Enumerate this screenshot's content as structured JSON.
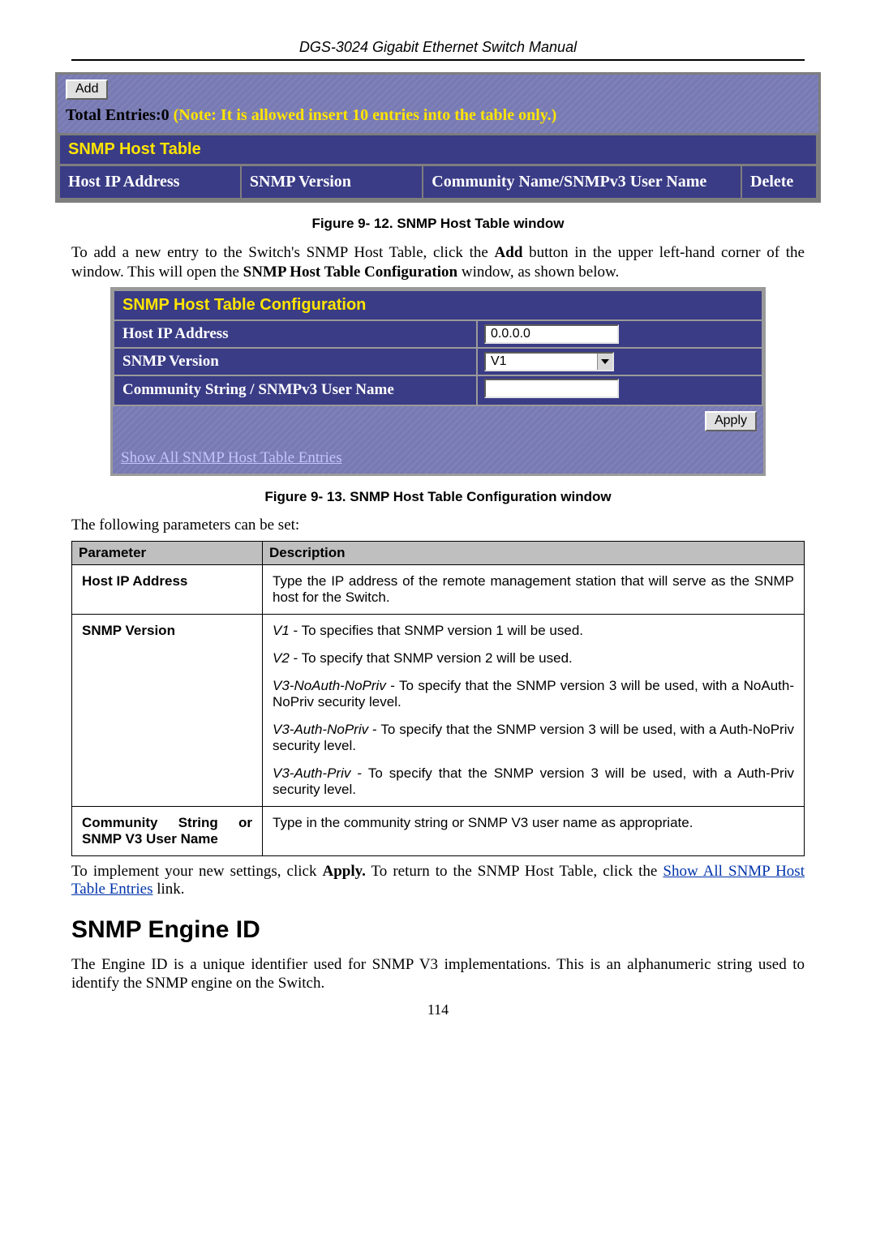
{
  "header": {
    "doc_title": "DGS-3024 Gigabit Ethernet Switch Manual"
  },
  "shot1": {
    "add_btn": "Add",
    "total_prefix": "Total Entries:0 ",
    "total_note": "(Note: It is allowed insert 10 entries into the table only.)",
    "table_title": "SNMP Host Table",
    "cols": {
      "c0": "Host IP Address",
      "c1": "SNMP Version",
      "c2": "Community Name/SNMPv3 User Name",
      "c3": "Delete"
    }
  },
  "caption1": "Figure 9- 12. SNMP Host Table window",
  "para1_a": "To add a new entry to the Switch's SNMP Host Table, click the ",
  "para1_bold": "Add",
  "para1_b": " button in the upper left-hand corner of the window. This will open the ",
  "para1_bold2": "SNMP Host Table Configuration",
  "para1_c": " window, as shown below.",
  "shot2": {
    "title": "SNMP Host Table Configuration",
    "rows": {
      "r0": "Host IP Address",
      "r1": "SNMP Version",
      "r2": "Community String / SNMPv3 User Name"
    },
    "ip_value": "0.0.0.0",
    "ver_value": "V1",
    "community_value": "",
    "apply": "Apply",
    "link": "Show All SNMP Host Table Entries"
  },
  "caption2": "Figure 9- 13. SNMP Host Table Configuration window",
  "param_intro": "The following parameters can be set:",
  "param_head": {
    "c0": "Parameter",
    "c1": "Description"
  },
  "params": {
    "p0": {
      "name": "Host IP Address",
      "desc": "Type the IP address of the remote management station that will serve as the SNMP host for the Switch."
    },
    "p1": {
      "name": "SNMP Version",
      "d1a": "V1",
      "d1b": " - To specifies that SNMP version 1 will be used.",
      "d2a": "V2",
      "d2b": " - To specify that SNMP version 2 will be used.",
      "d3a": "V3-NoAuth-NoPriv",
      "d3b": " - To specify that the SNMP version 3 will be used, with a NoAuth-NoPriv security level.",
      "d4a": "V3-Auth-NoPriv",
      "d4b": " - To specify that the SNMP version 3 will be used, with a Auth-NoPriv security level.",
      "d5a": "V3-Auth-Priv",
      "d5b": " - To specify that the SNMP version 3 will be used, with a Auth-Priv security level."
    },
    "p2": {
      "name": "Community String or SNMP V3 User Name",
      "desc": "Type in the community string or SNMP V3 user name as appropriate."
    }
  },
  "aftertext_a": "To implement your new settings, click ",
  "aftertext_bold": "Apply.",
  "aftertext_b": " To return to the SNMP Host Table, click the ",
  "aftertext_link": "Show All SNMP Host Table Entries",
  "aftertext_c": " link.",
  "section_heading": "SNMP Engine ID",
  "engine_para": "The Engine ID is a unique identifier used for SNMP V3 implementations. This is an alphanumeric string used to identify the SNMP engine on the Switch.",
  "page_number": "114"
}
